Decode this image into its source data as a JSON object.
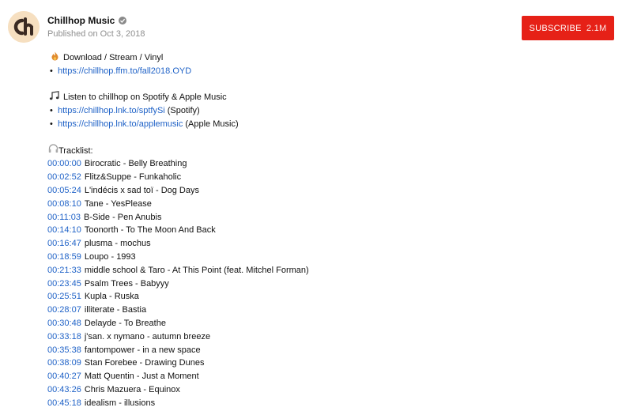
{
  "channel": {
    "name": "Chillhop Music",
    "published": "Published on Oct 3, 2018",
    "avatar_letters": "Ch",
    "avatar_color": "#f6dfc0"
  },
  "subscribe": {
    "label": "SUBSCRIBE",
    "count": "2.1M",
    "color": "#e62117"
  },
  "description": {
    "download": {
      "icon": "flame-icon",
      "text": "Download / Stream / Vinyl",
      "bullet": "•",
      "link": "https://chillhop.ffm.to/fall2018.OYD"
    },
    "listen": {
      "icon": "music-note-icon",
      "text": "Listen to chillhop on Spotify & Apple Music",
      "links": [
        {
          "bullet": "•",
          "url": "https://chillhop.lnk.to/sptfySi",
          "suffix": "(Spotify)"
        },
        {
          "bullet": "•",
          "url": "https://chillhop.lnk.to/applemusic",
          "suffix": "(Apple Music)"
        }
      ]
    },
    "tracklist_label": "Tracklist:",
    "tracks": [
      {
        "time": "00:00:00",
        "title": "Birocratic - Belly Breathing"
      },
      {
        "time": "00:02:52",
        "title": "Flitz&Suppe - Funkaholic"
      },
      {
        "time": "00:05:24",
        "title": "L'indécis x sad toï - Dog Days"
      },
      {
        "time": "00:08:10",
        "title": "Tane - YesPlease"
      },
      {
        "time": "00:11:03",
        "title": "B-Side - Pen Anubis"
      },
      {
        "time": "00:14:10",
        "title": "Toonorth - To The Moon And Back"
      },
      {
        "time": "00:16:47",
        "title": "plusma - mochus"
      },
      {
        "time": "00:18:59",
        "title": "Loupo - 1993"
      },
      {
        "time": "00:21:33",
        "title": "middle school & Taro - At This Point (feat. Mitchel Forman)"
      },
      {
        "time": "00:23:45",
        "title": "Psalm Trees - Babyyy"
      },
      {
        "time": "00:25:51",
        "title": "Kupla - Ruska"
      },
      {
        "time": "00:28:07",
        "title": "illiterate - Bastia"
      },
      {
        "time": "00:30:48",
        "title": "Delayde - To Breathe"
      },
      {
        "time": "00:33:18",
        "title": "j'san. x nymano - autumn breeze"
      },
      {
        "time": "00:35:38",
        "title": "fantompower - in a new space"
      },
      {
        "time": "00:38:09",
        "title": "Stan Forebee - Drawing Dunes"
      },
      {
        "time": "00:40:27",
        "title": "Matt Quentin - Just a Moment"
      },
      {
        "time": "00:43:26",
        "title": "Chris Mazuera - Equinox"
      },
      {
        "time": "00:45:18",
        "title": "idealism - illusions"
      }
    ]
  }
}
